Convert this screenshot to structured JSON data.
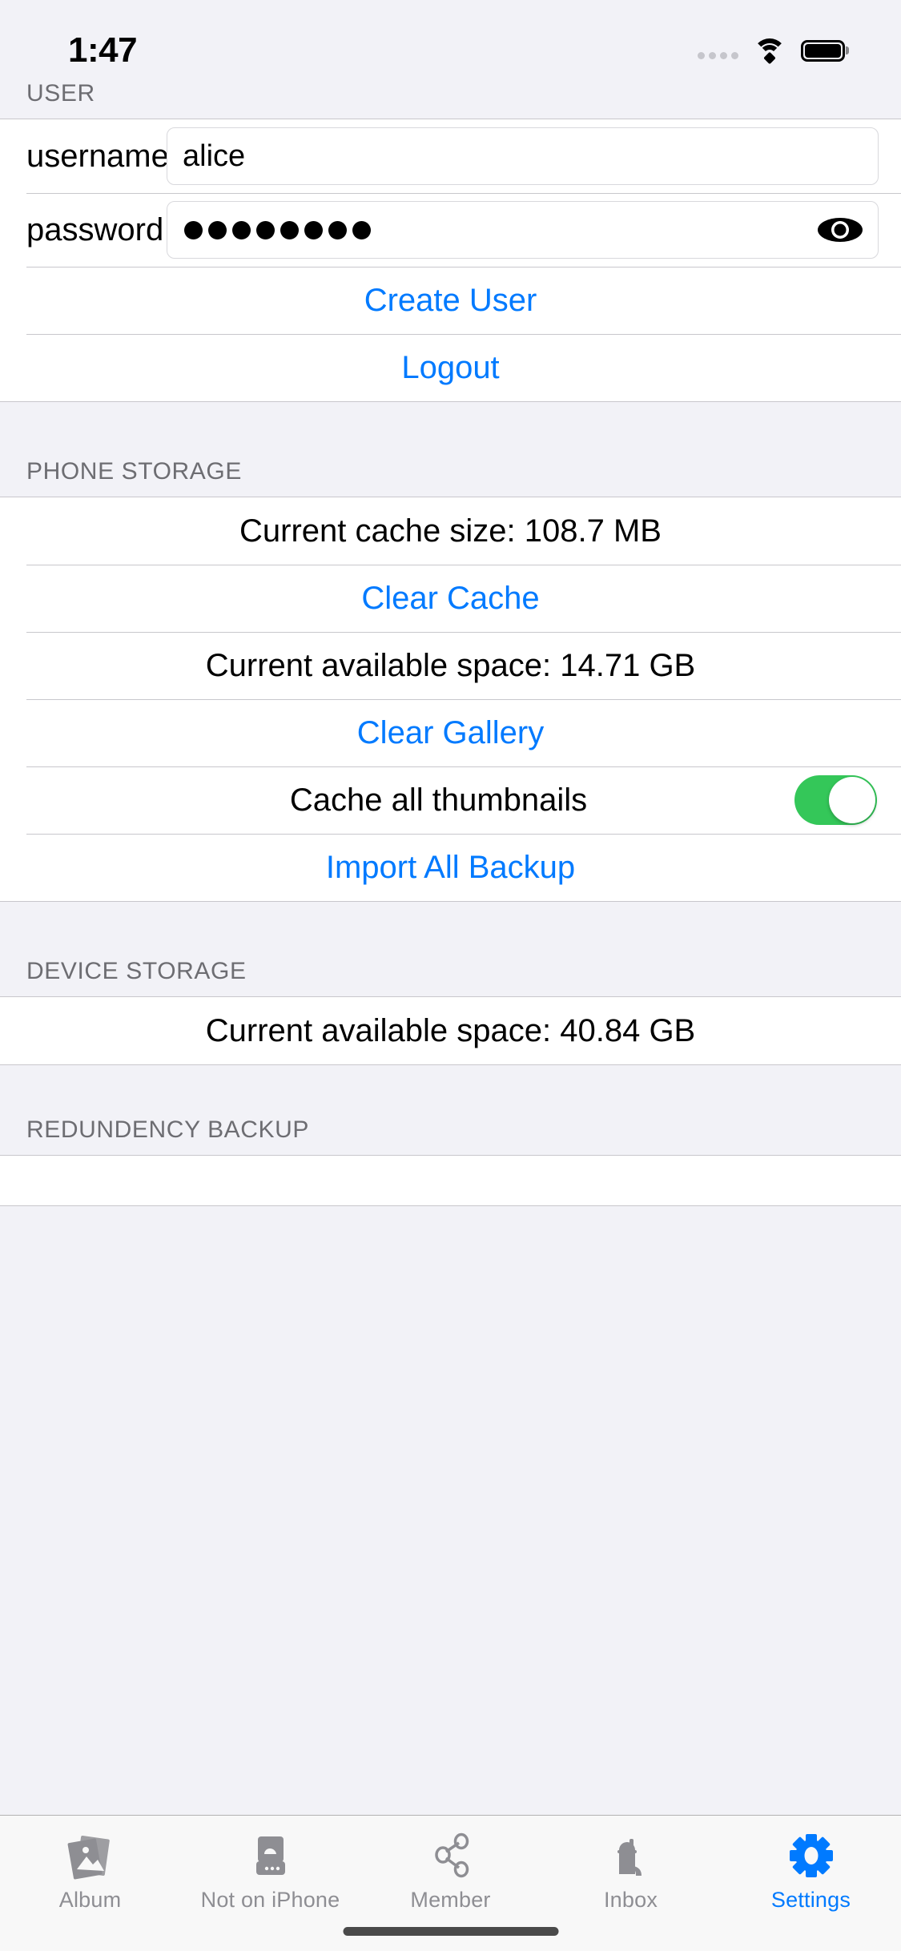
{
  "status_bar": {
    "time": "1:47",
    "signal_icon": "signal-dots-icon",
    "wifi_icon": "wifi-icon",
    "battery_icon": "battery-full-icon"
  },
  "sections": {
    "user": {
      "header": "USER",
      "username_label": "username",
      "username_value": "alice",
      "password_label": "password",
      "password_value": "••••••••",
      "password_dot_count": 8,
      "show_password_icon": "eye-icon",
      "create_user_label": "Create User",
      "logout_label": "Logout"
    },
    "phone_storage": {
      "header": "PHONE STORAGE",
      "cache_size_text": "Current cache size: 108.7 MB",
      "clear_cache_label": "Clear Cache",
      "available_space_text": "Current available space: 14.71 GB",
      "clear_gallery_label": "Clear Gallery",
      "cache_thumbnails_label": "Cache all thumbnails",
      "cache_thumbnails_on": true,
      "import_backup_label": "Import All Backup"
    },
    "device_storage": {
      "header": "DEVICE STORAGE",
      "available_space_text": "Current available space: 40.84 GB"
    },
    "redundency_backup": {
      "header": "REDUNDENCY BACKUP"
    }
  },
  "tabbar": {
    "items": [
      {
        "label": "Album",
        "icon": "photo-stack-icon",
        "active": false
      },
      {
        "label": "Not on iPhone",
        "icon": "cloud-drive-icon",
        "active": false
      },
      {
        "label": "Member",
        "icon": "share-nodes-icon",
        "active": false
      },
      {
        "label": "Inbox",
        "icon": "mailbox-icon",
        "active": false
      },
      {
        "label": "Settings",
        "icon": "gear-icon",
        "active": true
      }
    ]
  },
  "colors": {
    "accent_blue": "#007aff",
    "toggle_green": "#34c759",
    "group_bg": "#f2f2f7",
    "separator": "#c8c7cc",
    "muted_text": "#6d6d72",
    "tab_inactive": "#8e8e93"
  }
}
